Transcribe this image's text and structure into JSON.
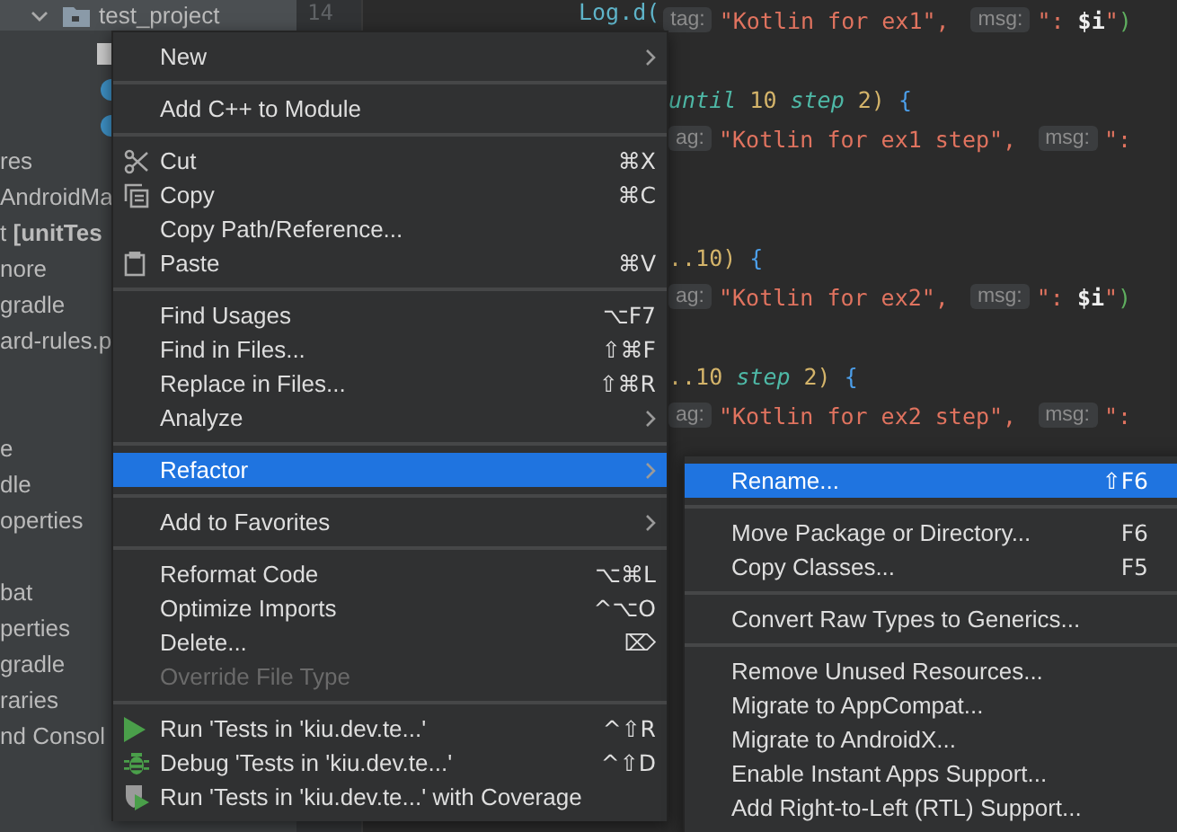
{
  "tree": {
    "sections": [
      {
        "rows": [
          {
            "label": "test_project",
            "kind": "open-folder",
            "selected": true
          },
          {
            "kind": "file",
            "selected": false
          },
          {
            "kind": "class",
            "selected": false
          },
          {
            "kind": "class",
            "selected": false
          },
          {
            "label": "res",
            "kind": "text",
            "selected": false
          },
          {
            "label": "AndroidMa",
            "kind": "text",
            "selected": false
          },
          {
            "label": "t **[unitTes**",
            "kind": "text",
            "selected": false
          },
          {
            "label": "nore",
            "kind": "text",
            "selected": false
          },
          {
            "label": "gradle",
            "kind": "text",
            "selected": false
          },
          {
            "label": "ard-rules.p",
            "kind": "text",
            "selected": false
          }
        ]
      },
      {
        "rows": [
          {
            "label": "e",
            "kind": "text",
            "selected": false
          },
          {
            "label": "dle",
            "kind": "text",
            "selected": false
          },
          {
            "label": "operties",
            "kind": "text",
            "selected": false
          }
        ]
      },
      {
        "rows": [
          {
            "label": "bat",
            "kind": "text",
            "selected": false
          },
          {
            "label": "perties",
            "kind": "text",
            "selected": false
          },
          {
            "label": "gradle",
            "kind": "text",
            "selected": false
          },
          {
            "label": "raries",
            "kind": "text",
            "selected": false
          },
          {
            "label": "nd Consol",
            "kind": "text",
            "selected": false
          }
        ]
      }
    ]
  },
  "editor": {
    "line_number": "14",
    "blocks": [
      {
        "lines": [
          {
            "segments": [
              {
                "kind": "call",
                "text": "Log.d("
              },
              {
                "kind": "hint",
                "text": "tag:"
              },
              {
                "kind": "string",
                "text": "\"Kotlin for ex1\""
              },
              {
                "kind": "plain",
                "text": ","
              },
              {
                "kind": "hint",
                "text": "msg:"
              },
              {
                "kind": "string",
                "text": "\": "
              },
              {
                "kind": "interp",
                "text": "$i"
              },
              {
                "kind": "string",
                "text": "\""
              },
              {
                "kind": "close",
                "text": ")"
              }
            ]
          }
        ]
      },
      {
        "lines": [
          {
            "segments": [
              {
                "kind": "keyword",
                "text": "until"
              },
              {
                "kind": "number",
                "text": " 10 "
              },
              {
                "kind": "keyword",
                "text": "step"
              },
              {
                "kind": "number",
                "text": " 2)"
              },
              {
                "kind": "brace",
                "text": " {"
              }
            ]
          },
          {
            "segments": [
              {
                "kind": "hint",
                "text": "ag:"
              },
              {
                "kind": "string",
                "text": "\"Kotlin for ex1 step\""
              },
              {
                "kind": "plain",
                "text": ","
              },
              {
                "kind": "hint",
                "text": "msg:"
              },
              {
                "kind": "string",
                "text": "\":"
              }
            ]
          }
        ]
      },
      {
        "lines": [
          {
            "segments": [
              {
                "kind": "number",
                "text": "..10)"
              },
              {
                "kind": "brace",
                "text": " {"
              }
            ]
          },
          {
            "segments": [
              {
                "kind": "hint",
                "text": "ag:"
              },
              {
                "kind": "string",
                "text": "\"Kotlin for ex2\""
              },
              {
                "kind": "plain",
                "text": ","
              },
              {
                "kind": "hint",
                "text": "msg:"
              },
              {
                "kind": "string",
                "text": "\": "
              },
              {
                "kind": "interp",
                "text": "$i"
              },
              {
                "kind": "string",
                "text": "\""
              },
              {
                "kind": "close",
                "text": ")"
              }
            ]
          }
        ]
      },
      {
        "lines": [
          {
            "segments": [
              {
                "kind": "number",
                "text": "..10 "
              },
              {
                "kind": "keyword",
                "text": "step"
              },
              {
                "kind": "number",
                "text": " 2)"
              },
              {
                "kind": "brace",
                "text": " {"
              }
            ]
          },
          {
            "segments": [
              {
                "kind": "hint",
                "text": "ag:"
              },
              {
                "kind": "string",
                "text": "\"Kotlin for ex2 step\""
              },
              {
                "kind": "plain",
                "text": ","
              },
              {
                "kind": "hint",
                "text": "msg:"
              },
              {
                "kind": "string",
                "text": "\":"
              }
            ]
          }
        ]
      }
    ]
  },
  "menu": {
    "groups": [
      {
        "items": [
          {
            "label": "New",
            "kind": "plain",
            "submenu": true,
            "selected": false,
            "disabled": false
          }
        ]
      },
      {
        "items": [
          {
            "label": "Add C++ to Module",
            "kind": "plain",
            "submenu": false,
            "selected": false,
            "disabled": false
          }
        ]
      },
      {
        "items": [
          {
            "label": "Cut",
            "kind": "cut",
            "shortcut": "⌘X",
            "submenu": false,
            "selected": false,
            "disabled": false
          },
          {
            "label": "Copy",
            "kind": "copy",
            "shortcut": "⌘C",
            "submenu": false,
            "selected": false,
            "disabled": false
          },
          {
            "label": "Copy Path/Reference...",
            "kind": "plain",
            "submenu": false,
            "selected": false,
            "disabled": false
          },
          {
            "label": "Paste",
            "kind": "paste",
            "shortcut": "⌘V",
            "submenu": false,
            "selected": false,
            "disabled": false
          }
        ]
      },
      {
        "items": [
          {
            "label": "Find Usages",
            "kind": "plain",
            "shortcut": "⌥F7",
            "submenu": false,
            "selected": false,
            "disabled": false
          },
          {
            "label": "Find in Files...",
            "kind": "plain",
            "shortcut": "⇧⌘F",
            "submenu": false,
            "selected": false,
            "disabled": false
          },
          {
            "label": "Replace in Files...",
            "kind": "plain",
            "shortcut": "⇧⌘R",
            "submenu": false,
            "selected": false,
            "disabled": false
          },
          {
            "label": "Analyze",
            "kind": "plain",
            "submenu": true,
            "selected": false,
            "disabled": false
          }
        ]
      },
      {
        "items": [
          {
            "label": "Refactor",
            "kind": "plain",
            "submenu": true,
            "selected": true,
            "disabled": false
          }
        ]
      },
      {
        "items": [
          {
            "label": "Add to Favorites",
            "kind": "plain",
            "submenu": true,
            "selected": false,
            "disabled": false
          }
        ]
      },
      {
        "items": [
          {
            "label": "Reformat Code",
            "kind": "plain",
            "shortcut": "⌥⌘L",
            "submenu": false,
            "selected": false,
            "disabled": false
          },
          {
            "label": "Optimize Imports",
            "kind": "plain",
            "shortcut": "^⌥O",
            "submenu": false,
            "selected": false,
            "disabled": false
          },
          {
            "label": "Delete...",
            "kind": "plain",
            "shortcut": "⌦",
            "submenu": false,
            "selected": false,
            "disabled": false
          },
          {
            "label": "Override File Type",
            "kind": "plain",
            "submenu": false,
            "selected": false,
            "disabled": true
          }
        ]
      },
      {
        "items": [
          {
            "label": "Run 'Tests in 'kiu.dev.te...'",
            "kind": "run",
            "shortcut": "^⇧R",
            "submenu": false,
            "selected": false,
            "disabled": false
          },
          {
            "label": "Debug 'Tests in 'kiu.dev.te...'",
            "kind": "debug",
            "shortcut": "^⇧D",
            "submenu": false,
            "selected": false,
            "disabled": false
          },
          {
            "label": "Run 'Tests in 'kiu.dev.te...' with Coverage",
            "kind": "coverage",
            "submenu": false,
            "selected": false,
            "disabled": false
          }
        ]
      }
    ]
  },
  "submenu": {
    "groups": [
      {
        "items": [
          {
            "label": "Rename...",
            "shortcut": "⇧F6",
            "selected": true
          }
        ]
      },
      {
        "items": [
          {
            "label": "Move Package or Directory...",
            "shortcut": "F6",
            "selected": false
          },
          {
            "label": "Copy Classes...",
            "shortcut": "F5",
            "selected": false
          }
        ]
      },
      {
        "items": [
          {
            "label": "Convert Raw Types to Generics...",
            "selected": false
          }
        ]
      },
      {
        "items": [
          {
            "label": "Remove Unused Resources...",
            "selected": false
          },
          {
            "label": "Migrate to AppCompat...",
            "selected": false
          },
          {
            "label": "Migrate to AndroidX...",
            "selected": false
          },
          {
            "label": "Enable Instant Apps Support...",
            "selected": false
          },
          {
            "label": "Add Right-to-Left (RTL) Support...",
            "selected": false
          }
        ]
      }
    ]
  }
}
